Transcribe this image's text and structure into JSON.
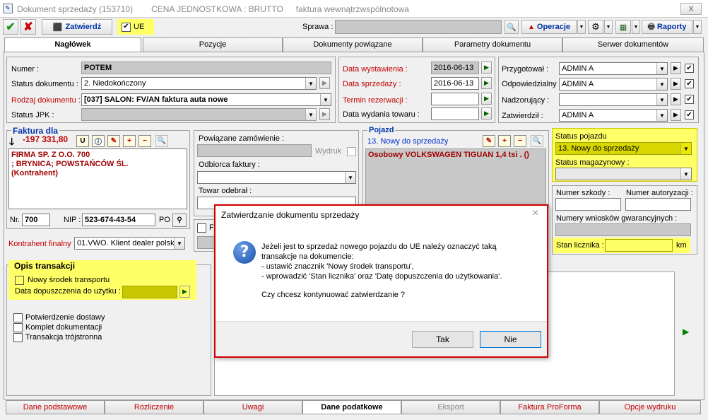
{
  "window": {
    "title": "Dokument sprzedaży (153710)",
    "price_mode": "CENA JEDNOSTKOWA : BRUTTO",
    "invoice_type": "faktura wewnątrzwspólnotowa",
    "close_label": "X"
  },
  "toolbar": {
    "confirm_label": "Zatwierdź",
    "ue_label": "UE",
    "ue_checked": "✔",
    "sprawa_label": "Sprawa :",
    "sprawa_value": "",
    "operacje_label": "Operacje",
    "raporty_label": "Raporty"
  },
  "tabs": [
    "Nagłówek",
    "Pozycje",
    "Dokumenty powiązane",
    "Parametry dokumentu",
    "Serwer dokumentów"
  ],
  "header": {
    "numer_label": "Numer :",
    "numer_value": "POTEM",
    "status_label": "Status dokumentu :",
    "status_value": "2. Niedokończony",
    "rodzaj_label": "Rodzaj dokumentu :",
    "rodzaj_value": "[037] SALON: FV/AN faktura auta nowe",
    "jpk_label": "Status JPK :",
    "jpk_value": ""
  },
  "dates": {
    "wystawienia_label": "Data wystawienia :",
    "wystawienia_value": "2016-06-13",
    "sprzedazy_label": "Data sprzedaży :",
    "sprzedazy_value": "2016-06-13",
    "rezerwacji_label": "Termin rezerwacji :",
    "rezerwacji_value": "",
    "wydania_label": "Data wydania towaru :",
    "wydania_value": ""
  },
  "people": {
    "przygotowal_label": "Przygotował :",
    "przygotowal_value": "ADMIN A",
    "odpowiedzialny_label": "Odpowiedzialny :",
    "odpowiedzialny_value": "ADMIN A",
    "nadzorujacy_label": "Nadzorujący :",
    "nadzorujacy_value": "",
    "zatwierdzil_label": "Zatwierdził :",
    "zatwierdzil_value": "ADMIN A"
  },
  "faktura": {
    "title": "Faktura dla",
    "amount": "-197 331,80",
    "client": "FIRMA SP. Z O.O. 700\n; BRYNICA;  POWSTAŃCÓW ŚL.\n(Kontrahent)",
    "nr_label": "Nr.",
    "nr_value": "700",
    "nip_label": "NIP :",
    "nip_value": "523-674-43-54",
    "po_label": "PO"
  },
  "kontrahent_finalny": {
    "label": "Kontrahent finalny :",
    "value": "01.VWO. Klient dealer polski"
  },
  "middle": {
    "powiazane_label": "Powiązane zamówienie :",
    "wydruk_label": "Wydruk",
    "odbiorca_label": "Odbiorca faktury :",
    "towar_label": "Towar odebrał :",
    "f_label": "F"
  },
  "pojazd": {
    "title": "Pojazd",
    "status": "13. Nowy do sprzedaży",
    "vehicle": "Osobowy VOLKSWAGEN TIGUAN 1,4 tsi . ()"
  },
  "status_pojazdu": {
    "label": "Status pojazdu",
    "value": "13. Nowy do sprzedaży",
    "magazyn_label": "Status magazynowy :",
    "magazyn_value": ""
  },
  "szkody": {
    "szkody_label": "Numer szkody :",
    "autoryzacji_label": "Numer autoryzacji :",
    "wnioski_label": "Numery wniosków gwarancyjnych :",
    "licznik_label": "Stan licznika :",
    "licznik_unit": "km"
  },
  "opis": {
    "title": "Opis transakcji",
    "nowy_srodek": "Nowy środek transportu",
    "data_dopuszczenia": "Data dopuszczenia do użytku :",
    "potwierdzenie": "Potwierdzenie dostawy",
    "komplet": "Komplet dokumentacji",
    "trojstronna": "Transakcja trójstronna"
  },
  "dialog": {
    "title": "Zatwierdzanie dokumentu sprzedaży",
    "line1": "Jeżeli jest to sprzedaż nowego pojazdu do UE należy oznaczyć taką",
    "line2": "transakcje na dokumencie:",
    "line3": "- ustawić znacznik 'Nowy środek transportu',",
    "line4": "- wprowadzić 'Stan licznika' oraz 'Datę dopuszczenia do użytkowania'.",
    "question": "Czy chcesz kontynuować zatwierdzanie ?",
    "yes": "Tak",
    "no": "Nie",
    "close": "×"
  },
  "bottom_tabs": [
    "Dane podstawowe",
    "Rozliczenie",
    "Uwagi",
    "Dane podatkowe",
    "Eksport",
    "Faktura ProForma",
    "Opcje wydruku"
  ],
  "colors": {
    "highlight": "#ffff66",
    "accent_red": "#c00000",
    "dialog_border": "#d00000"
  }
}
